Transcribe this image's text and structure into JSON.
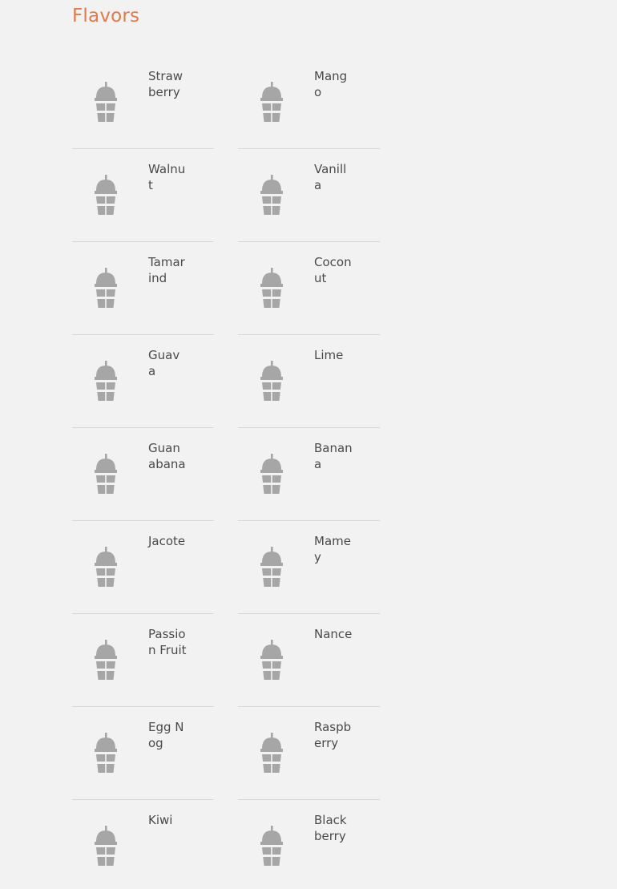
{
  "section": {
    "title": "Flavors"
  },
  "flavors": [
    {
      "name": "Strawberry",
      "icon": "smoothie-cup-icon"
    },
    {
      "name": "Mango",
      "icon": "smoothie-cup-icon"
    },
    {
      "name": "Walnut",
      "icon": "smoothie-cup-icon"
    },
    {
      "name": "Vanilla",
      "icon": "smoothie-cup-icon"
    },
    {
      "name": "Tamarind",
      "icon": "smoothie-cup-icon"
    },
    {
      "name": "Coconut",
      "icon": "smoothie-cup-icon"
    },
    {
      "name": "Guava",
      "icon": "smoothie-cup-icon"
    },
    {
      "name": "Lime",
      "icon": "smoothie-cup-icon"
    },
    {
      "name": "Guanabana",
      "icon": "smoothie-cup-icon"
    },
    {
      "name": "Banana",
      "icon": "smoothie-cup-icon"
    },
    {
      "name": "Jacote",
      "icon": "smoothie-cup-icon"
    },
    {
      "name": "Mamey",
      "icon": "smoothie-cup-icon"
    },
    {
      "name": "Passion Fruit",
      "icon": "smoothie-cup-icon"
    },
    {
      "name": "Nance",
      "icon": "smoothie-cup-icon"
    },
    {
      "name": "Egg Nog",
      "icon": "smoothie-cup-icon"
    },
    {
      "name": "Raspberry",
      "icon": "smoothie-cup-icon"
    },
    {
      "name": "Kiwi",
      "icon": "smoothie-cup-icon"
    },
    {
      "name": "Blackberry",
      "icon": "smoothie-cup-icon"
    }
  ],
  "colors": {
    "accent": "#e07a4a",
    "icon": "#a6a6a6",
    "text": "#4a4a4a",
    "background": "#f2f2f2",
    "divider": "#d6d6d6"
  }
}
